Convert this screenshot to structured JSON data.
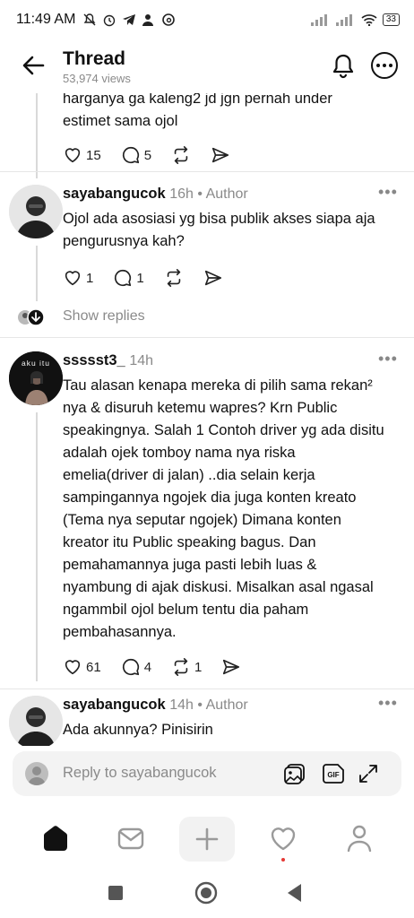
{
  "status_bar": {
    "time": "11:49 AM",
    "battery": "33"
  },
  "header": {
    "title": "Thread",
    "views": "53,974 views"
  },
  "top_partial": {
    "line1": "harganya ga kaleng2 jd jgn pernah under",
    "line2": "estimet sama ojol",
    "likes": "15",
    "replies": "5"
  },
  "comments": [
    {
      "username": "sayabangucok",
      "time": "16h",
      "tag": "Author",
      "lines": [
        "Ojol ada asosiasi yg bisa publik akses siapa aja",
        "pengurusnya kah?"
      ],
      "likes": "1",
      "replies": "1"
    },
    {
      "username": "ssssst3_",
      "time": "14h",
      "avatar_text": "aku itu",
      "lines": [
        "Tau alasan kenapa mereka di pilih sama rekan²",
        "nya & disuruh ketemu wapres? Krn Public",
        "speakingnya. Salah 1 Contoh driver yg ada disitu",
        "adalah ojek tomboy nama nya riska",
        "emelia(driver di jalan) ..dia selain kerja",
        "sampingannya ngojek dia juga konten kreato",
        "(Tema nya seputar ngojek)  Dimana konten",
        "kreator itu Public speaking bagus. Dan",
        "pemahamannya juga pasti lebih luas &",
        "nyambung di ajak diskusi. Misalkan asal ngasal",
        "ngammbil ojol belum tentu dia paham",
        "pembahasannya."
      ],
      "likes": "61",
      "replies": "4",
      "reposts": "1"
    },
    {
      "username": "sayabangucok",
      "time": "14h",
      "tag": "Author",
      "lines": [
        "Ada akunnya? Pinisirin"
      ]
    }
  ],
  "show_replies": "Show replies",
  "separator_dot": "•",
  "reply_box": {
    "placeholder": "Reply to sayabangucok"
  },
  "icons": [
    "back-arrow-icon",
    "bell-icon",
    "more-icon",
    "heart-icon",
    "comment-icon",
    "repost-icon",
    "share-icon",
    "gallery-icon",
    "gif-icon",
    "expand-icon",
    "home-icon",
    "inbox-icon",
    "plus-icon",
    "activity-icon",
    "profile-icon"
  ],
  "colors": {
    "notification_dot": "#e53935",
    "muted_text": "#8a8a8a"
  }
}
